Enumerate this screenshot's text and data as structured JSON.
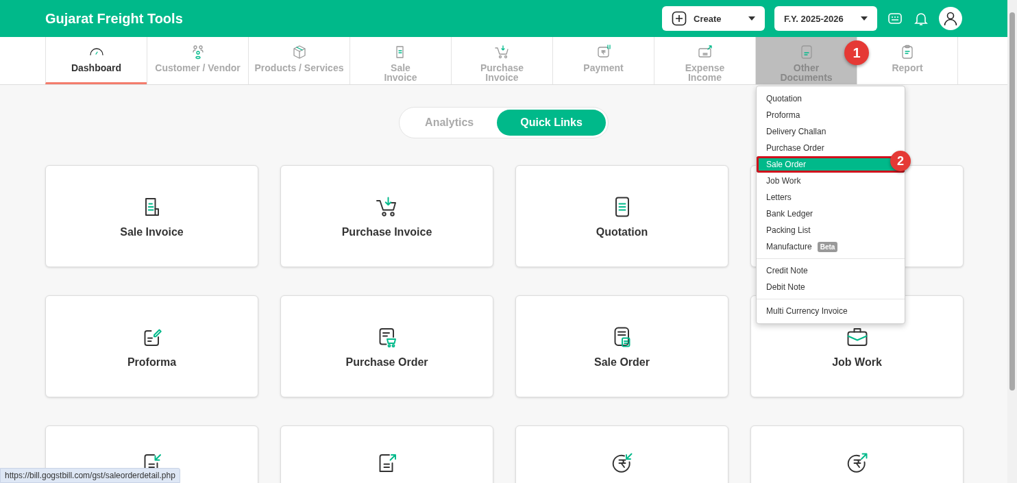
{
  "header": {
    "title": "Gujarat Freight Tools",
    "create_button": "Create",
    "year_select": "F.Y. 2025-2026"
  },
  "tabs": [
    {
      "label": "Dashboard",
      "selected": true,
      "open": false
    },
    {
      "label": "Customer / Vendor",
      "selected": false,
      "open": false
    },
    {
      "label": "Products / Services",
      "selected": false,
      "open": false
    },
    {
      "label": "Sale\nInvoice",
      "selected": false,
      "open": false
    },
    {
      "label": "Purchase\nInvoice",
      "selected": false,
      "open": false
    },
    {
      "label": "Payment",
      "selected": false,
      "open": false
    },
    {
      "label": "Expense\nIncome",
      "selected": false,
      "open": false
    },
    {
      "label": "Other\nDocuments",
      "selected": false,
      "open": true
    },
    {
      "label": "Report",
      "selected": false,
      "open": false
    }
  ],
  "step_badges": [
    "1",
    "2"
  ],
  "toggle": [
    {
      "label": "Analytics",
      "selected": false
    },
    {
      "label": "Quick Links",
      "selected": true
    }
  ],
  "cards": [
    {
      "kind": "labeled",
      "label": "Sale Invoice"
    },
    {
      "kind": "labeled",
      "label": "Purchase Invoice"
    },
    {
      "kind": "labeled",
      "label": "Quotation"
    },
    {
      "kind": "icon_only"
    },
    {
      "kind": "labeled",
      "label": "Proforma"
    },
    {
      "kind": "labeled",
      "label": "Purchase Order"
    },
    {
      "kind": "labeled",
      "label": "Sale Order"
    },
    {
      "kind": "labeled",
      "label": "Job Work"
    },
    {
      "kind": "icon_only"
    },
    {
      "kind": "icon_only"
    },
    {
      "kind": "icon_only"
    },
    {
      "kind": "icon_only"
    }
  ],
  "dropdown": {
    "groups": [
      [
        {
          "label": "Quotation",
          "selected": false
        },
        {
          "label": "Proforma",
          "selected": false
        },
        {
          "label": "Delivery Challan",
          "selected": false
        },
        {
          "label": "Purchase Order",
          "selected": false
        },
        {
          "label": "Sale Order",
          "selected": true
        },
        {
          "label": "Job Work",
          "selected": false
        },
        {
          "label": "Letters",
          "selected": false
        },
        {
          "label": "Bank Ledger",
          "selected": false
        },
        {
          "label": "Packing List",
          "selected": false
        },
        {
          "label": "Manufacture",
          "selected": false,
          "badge": "Beta"
        }
      ],
      [
        {
          "label": "Credit Note",
          "selected": false
        },
        {
          "label": "Debit Note",
          "selected": false
        }
      ],
      [
        {
          "label": "Multi Currency Invoice",
          "selected": false
        }
      ]
    ]
  },
  "status_url": "https://bill.gogstbill.com/gst/saleorderdetail.php"
}
